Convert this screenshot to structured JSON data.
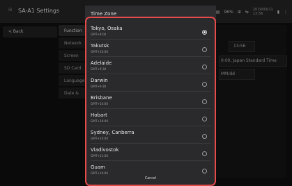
{
  "app": {
    "title": "SA-A1 Settings"
  },
  "status_bar": {
    "battery_text": "96%",
    "date": "2019/09/11",
    "time": "13:56"
  },
  "nav": {
    "back_label": "< Back"
  },
  "sidebar": {
    "items": [
      {
        "label": "Function"
      },
      {
        "label": "Network"
      },
      {
        "label": "Screen"
      },
      {
        "label": "SD Card"
      },
      {
        "label": "Language"
      },
      {
        "label": "Date &"
      }
    ]
  },
  "content": {
    "time_value": "13:56",
    "timezone_value": "0:00, Japan Standard Time",
    "date_format_value": "MM/dd"
  },
  "dialog": {
    "title": "Time Zone",
    "cancel_label": "Cancel",
    "items": [
      {
        "name": "Tokyo, Osaka",
        "offset": "GMT+9:00",
        "selected": true
      },
      {
        "name": "Yakutsk",
        "offset": "GMT+10:00",
        "selected": false
      },
      {
        "name": "Adelaide",
        "offset": "GMT+9:30",
        "selected": false
      },
      {
        "name": "Darwin",
        "offset": "GMT+9:30",
        "selected": false
      },
      {
        "name": "Brisbane",
        "offset": "GMT+10:00",
        "selected": false
      },
      {
        "name": "Hobart",
        "offset": "GMT+10:00",
        "selected": false
      },
      {
        "name": "Sydney, Canberra",
        "offset": "GMT+10:00",
        "selected": false
      },
      {
        "name": "Vladivostok",
        "offset": "GMT+11:00",
        "selected": false
      },
      {
        "name": "Guam",
        "offset": "GMT+10:00",
        "selected": false
      }
    ]
  },
  "colors": {
    "accent": "#e34b4b",
    "dialog_bg": "#2a2a2c",
    "background": "#0f0f10"
  }
}
